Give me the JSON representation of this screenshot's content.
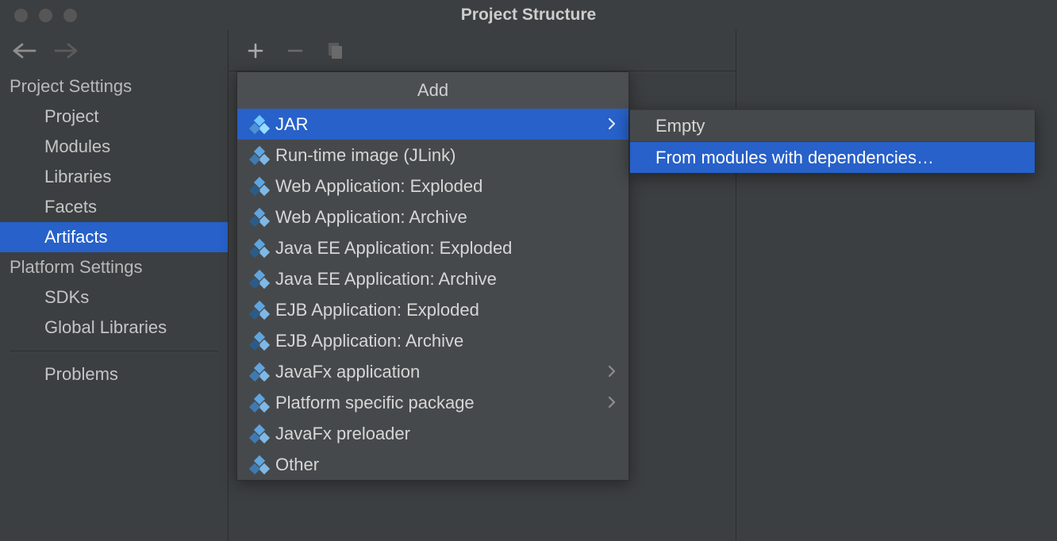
{
  "window": {
    "title": "Project Structure"
  },
  "sidebar": {
    "sections": [
      {
        "title": "Project Settings",
        "items": [
          "Project",
          "Modules",
          "Libraries",
          "Facets",
          "Artifacts"
        ]
      },
      {
        "title": "Platform Settings",
        "items": [
          "SDKs",
          "Global Libraries"
        ]
      }
    ],
    "after_separator_items": [
      "Problems"
    ],
    "selected": "Artifacts"
  },
  "add_menu": {
    "title": "Add",
    "items": [
      {
        "label": "JAR",
        "submenu": true,
        "selected": true
      },
      {
        "label": "Run-time image (JLink)"
      },
      {
        "label": "Web Application: Exploded",
        "variant": true
      },
      {
        "label": "Web Application: Archive",
        "variant": true
      },
      {
        "label": "Java EE Application: Exploded",
        "variant": true
      },
      {
        "label": "Java EE Application: Archive",
        "variant": true
      },
      {
        "label": "EJB Application: Exploded",
        "variant": true
      },
      {
        "label": "EJB Application: Archive",
        "variant": true
      },
      {
        "label": "JavaFx application",
        "submenu": true
      },
      {
        "label": "Platform specific package",
        "submenu": true
      },
      {
        "label": "JavaFx preloader"
      },
      {
        "label": "Other"
      }
    ]
  },
  "jar_submenu": {
    "items": [
      {
        "label": "Empty"
      },
      {
        "label": "From modules with dependencies…",
        "selected": true
      }
    ]
  }
}
